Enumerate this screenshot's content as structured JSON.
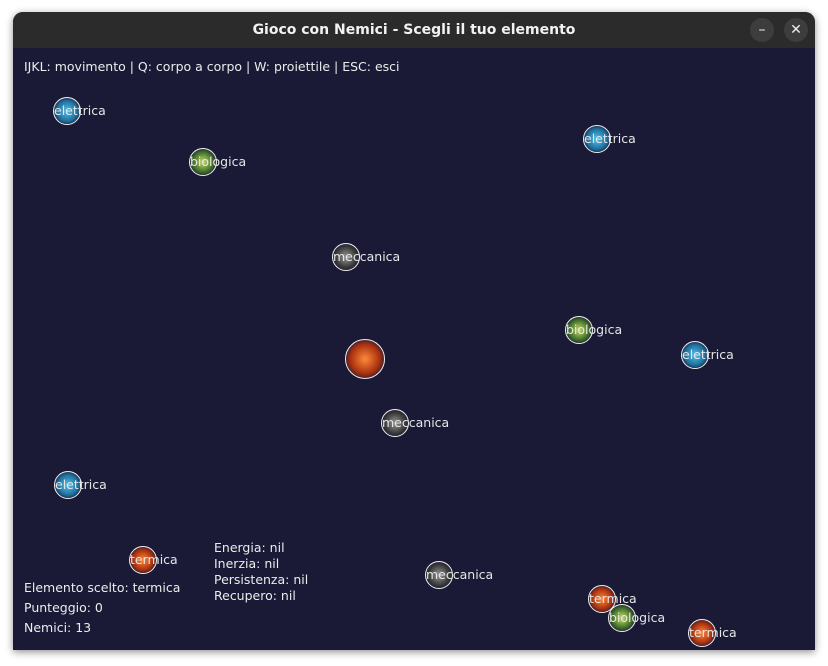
{
  "window": {
    "title": "Gioco con Nemici - Scegli il tuo elemento",
    "minimize_label": "–",
    "close_label": "✕"
  },
  "hud": {
    "controls": "IJKL: movimento | Q: corpo a corpo | W: proiettile | ESC: esci",
    "selected_element": "Elemento scelto: termica",
    "score": "Punteggio: 0",
    "enemies": "Nemici: 13",
    "stats": {
      "energia": "Energia: nil",
      "inerzia": "Inerzia: nil",
      "persistenza": "Persistenza: nil",
      "recupero": "Recupero: nil"
    }
  },
  "colors": {
    "background": "#1a1a36",
    "titlebar": "#2b2b2b",
    "elettrica": "#2b8fc0",
    "biologica": "#7f9a3a",
    "meccanica": "#5a5a5a",
    "termica": "#d9501e"
  },
  "enemies": [
    {
      "type": "elettrica",
      "label": "elettrica"
    },
    {
      "type": "biologica",
      "label": "biologica"
    },
    {
      "type": "elettrica",
      "label": "elettrica"
    },
    {
      "type": "meccanica",
      "label": "meccanica"
    },
    {
      "type": "biologica",
      "label": "biologica"
    },
    {
      "type": "elettrica",
      "label": "elettrica"
    },
    {
      "type": "meccanica",
      "label": "meccanica"
    },
    {
      "type": "elettrica",
      "label": "elettrica"
    },
    {
      "type": "termica",
      "label": "termica"
    },
    {
      "type": "meccanica",
      "label": "meccanica"
    },
    {
      "type": "termica",
      "label": "termica"
    },
    {
      "type": "biologica",
      "label": "biologica"
    },
    {
      "type": "termica",
      "label": "termica"
    }
  ],
  "player": {
    "type": "termica"
  }
}
